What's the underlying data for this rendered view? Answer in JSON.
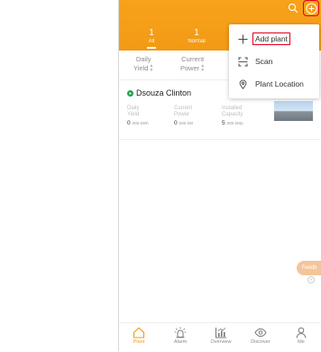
{
  "header": {
    "tabs": [
      {
        "count": "1",
        "label": "All"
      },
      {
        "count": "1",
        "label": "Normal"
      }
    ]
  },
  "sort_bar": [
    {
      "line1": "Daily",
      "line2": "Yield"
    },
    {
      "line1": "Current",
      "line2": "Power"
    }
  ],
  "menu": {
    "items": [
      {
        "label": "Add plant",
        "icon": "plus-icon"
      },
      {
        "label": "Scan",
        "icon": "scan-icon"
      },
      {
        "label": "Plant Location",
        "icon": "location-pin-icon"
      }
    ]
  },
  "plant": {
    "name": "Dsouza Clinton",
    "metrics": [
      {
        "label1": "Daily",
        "label2": "Yield",
        "value": "0",
        "unit": ".000 kWh"
      },
      {
        "label1": "Current",
        "label2": "Power",
        "value": "0",
        "unit": ".000 kW"
      },
      {
        "label1": "Installed",
        "label2": "Capacity",
        "value": "5",
        "unit": ".000 kWp"
      }
    ]
  },
  "feedback": {
    "label": "Feedb"
  },
  "nav": [
    {
      "label": "Plant",
      "icon": "home-icon"
    },
    {
      "label": "Alarm",
      "icon": "alarm-icon"
    },
    {
      "label": "Overview",
      "icon": "chart-icon"
    },
    {
      "label": "Discover",
      "icon": "eye-icon"
    },
    {
      "label": "Me",
      "icon": "person-icon"
    }
  ],
  "colors": {
    "accent": "#f39a16",
    "highlight": "#e1001e",
    "status_ok": "#24a148"
  }
}
